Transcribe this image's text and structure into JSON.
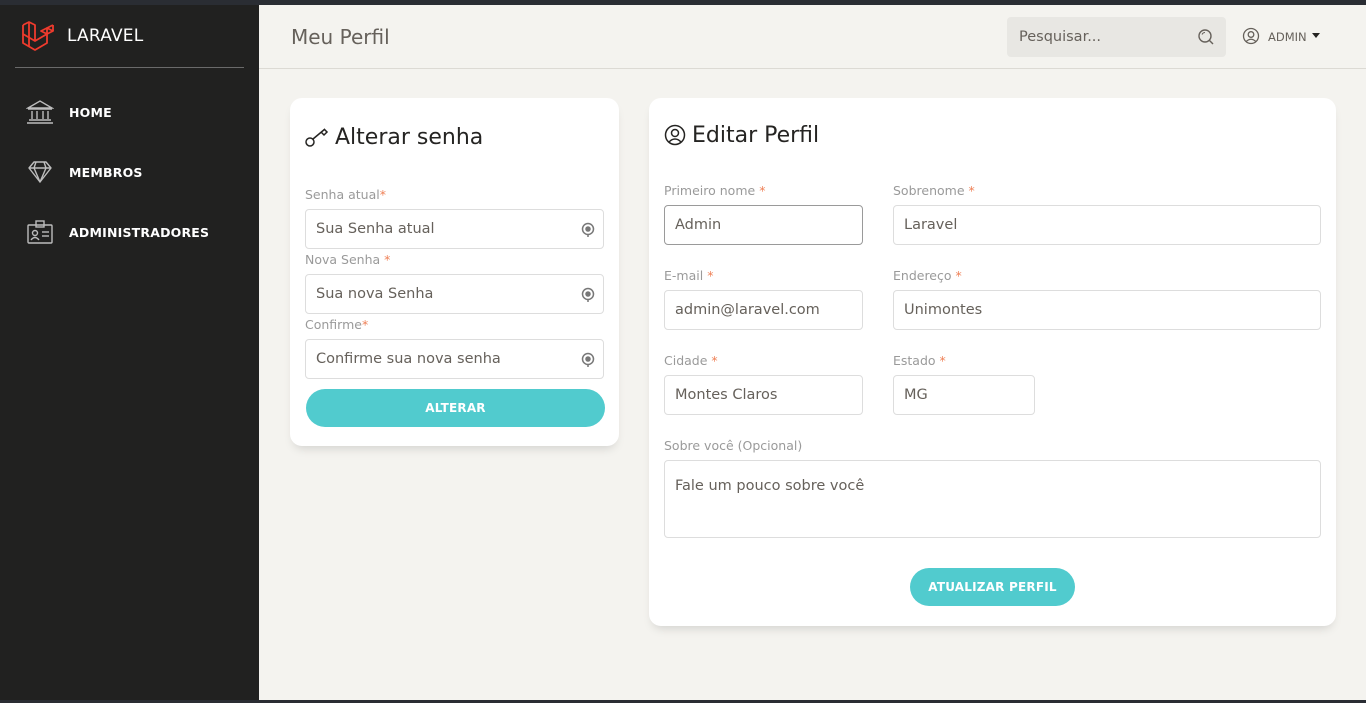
{
  "sidebar": {
    "brand": "LARAVEL",
    "items": [
      {
        "label": "HOME",
        "icon": "bank-icon"
      },
      {
        "label": "MEMBROS",
        "icon": "diamond-icon"
      },
      {
        "label": "ADMINISTRADORES",
        "icon": "id-badge-icon"
      }
    ],
    "brand_color": "#ef3b2d"
  },
  "header": {
    "title": "Meu Perfil",
    "search_placeholder": "Pesquisar...",
    "user_label": "ADMIN"
  },
  "password_card": {
    "title": "Alterar senha",
    "fields": [
      {
        "label": "Senha atual",
        "required": "*",
        "placeholder": "Sua Senha atual"
      },
      {
        "label": "Nova Senha",
        "required": "*",
        "placeholder": "Sua nova Senha"
      },
      {
        "label": "Confirme",
        "required": "*",
        "placeholder": "Confirme sua nova senha"
      }
    ],
    "button": "ALTERAR"
  },
  "profile_card": {
    "title": "Editar Perfil",
    "first_name": {
      "label": "Primeiro nome",
      "required": "*",
      "value": "Admin"
    },
    "last_name": {
      "label": "Sobrenome",
      "required": "*",
      "value": "Laravel"
    },
    "email": {
      "label": "E-mail",
      "required": "*",
      "value": "admin@laravel.com"
    },
    "address": {
      "label": "Endereço",
      "required": "*",
      "value": "Unimontes"
    },
    "city": {
      "label": "Cidade",
      "required": "*",
      "value": "Montes Claros"
    },
    "state": {
      "label": "Estado",
      "required": "*",
      "value": "MG"
    },
    "about": {
      "label": "Sobre você (Opcional)",
      "placeholder": "Fale um pouco sobre você"
    },
    "button": "ATUALIZAR PERFIL"
  },
  "colors": {
    "accent": "#51cbce",
    "sidebar_bg": "#212120",
    "page_bg": "#f4f3ef",
    "required": "#ef8157"
  }
}
